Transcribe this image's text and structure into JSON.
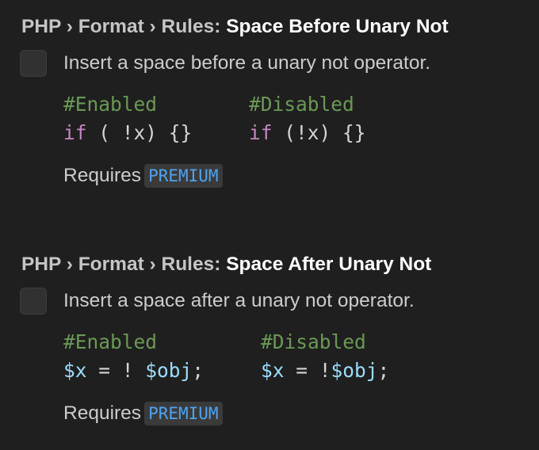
{
  "settings": [
    {
      "breadcrumb": "PHP › Format › Rules: ",
      "name": "Space Before Unary Not",
      "description": "Insert a space before a unary not operator.",
      "enabled_comment": "#Enabled",
      "disabled_comment": "#Disabled",
      "enabled_code": {
        "kw": "if",
        "rest": " ( !x) {}"
      },
      "disabled_code": {
        "kw": "if",
        "rest": " (!x) {}"
      },
      "requires_label": "Requires",
      "badge": "PREMIUM",
      "checked": false
    },
    {
      "breadcrumb": "PHP › Format › Rules: ",
      "name": "Space After Unary Not",
      "description": "Insert a space after a unary not operator.",
      "enabled_comment": "#Enabled",
      "disabled_comment": "#Disabled",
      "enabled_code": {
        "v1": "$x",
        "mid": " = ! ",
        "v2": "$obj",
        "end": ";"
      },
      "disabled_code": {
        "v1": "$x",
        "mid": " = !",
        "v2": "$obj",
        "end": ";"
      },
      "requires_label": "Requires",
      "badge": "PREMIUM",
      "checked": false
    }
  ],
  "colors": {
    "background": "#1f1f1f",
    "comment": "#6a9955",
    "keyword": "#c586c0",
    "variable": "#9cdcfe",
    "badge_text": "#4fa3f0"
  }
}
